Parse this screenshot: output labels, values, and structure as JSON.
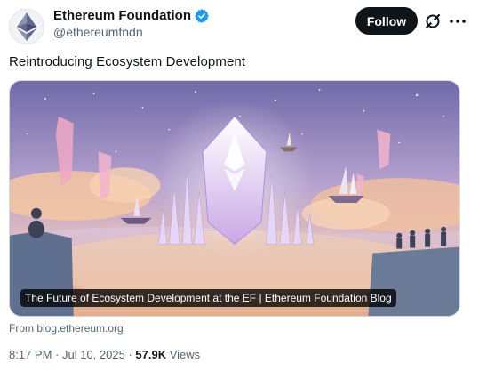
{
  "account": {
    "display_name": "Ethereum Foundation",
    "handle": "@ethereumfndn",
    "verified_color": "#1d9bf0"
  },
  "actions": {
    "follow_label": "Follow",
    "grok_icon": "grok-icon",
    "more_icon": "more-icon"
  },
  "tweet": {
    "text": "Reintroducing Ecosystem Development"
  },
  "card": {
    "title": "The Future of Ecosystem Development at the EF | Ethereum Foundation Blog",
    "source": "From blog.ethereum.org"
  },
  "meta": {
    "time": "8:17 PM",
    "separator": " · ",
    "date": "Jul 10, 2025",
    "separator2": " · ",
    "views_count": "57.9K",
    "views_label": " Views"
  }
}
